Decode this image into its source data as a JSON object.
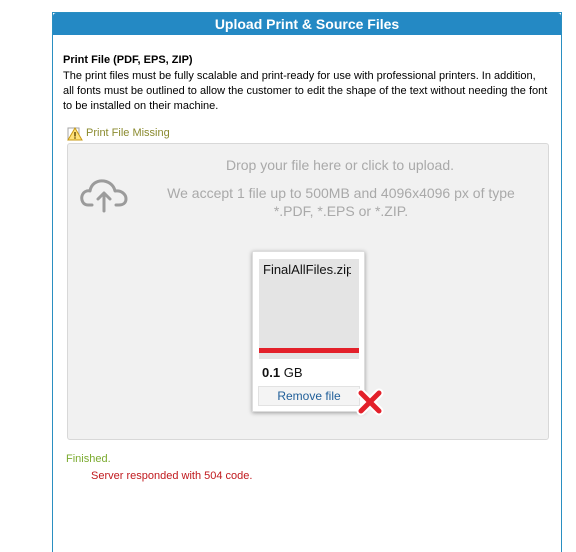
{
  "panel": {
    "title": "Upload Print & Source Files"
  },
  "section": {
    "title": "Print File (PDF, EPS, ZIP)",
    "description": "The print files must be fully scalable and print-ready for use with professional printers. In addition, all fonts must be outlined to allow the customer to edit the shape of the text without needing the font to be installed on their machine."
  },
  "warning": {
    "icon": "warning-icon",
    "text": "Print File Missing"
  },
  "dropzone": {
    "icon": "cloud-upload-icon",
    "title": "Drop your file here or click to upload.",
    "accept_text": "We accept 1 file up to 500MB and 4096x4096 px of type *.PDF, *.EPS or *.ZIP."
  },
  "file": {
    "name": "FinalAllFiles.zip",
    "size_value": "0.1",
    "size_unit": "GB",
    "progress_percent": 100,
    "progress_color": "#e3202a",
    "remove_label": "Remove file",
    "error_icon": "error-x-icon"
  },
  "status": {
    "finished": "Finished.",
    "error": "Server responded with 504 code."
  },
  "colors": {
    "header_bg": "#2489c4",
    "finished_text": "#7bab2f",
    "error_text": "#c0191d",
    "warning_text": "#8a8a2e"
  }
}
